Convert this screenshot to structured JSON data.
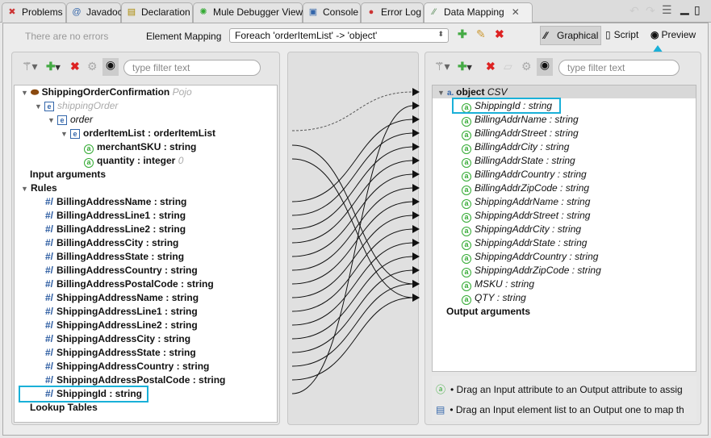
{
  "tabs": [
    {
      "label": "Problems",
      "icon": "problems-icon"
    },
    {
      "label": "Javadoc",
      "icon": "at-icon"
    },
    {
      "label": "Declaration",
      "icon": "declaration-icon"
    },
    {
      "label": "Mule Debugger View",
      "icon": "bug-icon"
    },
    {
      "label": "Console",
      "icon": "console-icon"
    },
    {
      "label": "Error Log",
      "icon": "error-log-icon"
    },
    {
      "label": "Data Mapping",
      "icon": "data-mapping-icon",
      "active": true
    }
  ],
  "toolbar": {
    "status": "There are no errors",
    "element_mapping_label": "Element Mapping",
    "element_mapping_value": "Foreach 'orderItemList' -> 'object'",
    "graphical": "Graphical",
    "script": "Script",
    "preview": "Preview"
  },
  "input": {
    "filter_placeholder": "type filter text",
    "root": {
      "name": "ShippingOrderConfirmation",
      "type": "Pojo"
    },
    "shipping_order": "shippingOrder",
    "order": "order",
    "item_list": "orderItemList : orderItemList",
    "merchant_sku": "merchantSKU : string",
    "quantity": "quantity : integer",
    "quantity_value": "0",
    "input_arguments": "Input arguments",
    "rules": "Rules",
    "rule_items": [
      "BillingAddressName : string",
      "BillingAddressLine1 : string",
      "BillingAddressLine2 : string",
      "BillingAddressCity : string",
      "BillingAddressState : string",
      "BillingAddressCountry : string",
      "BillingAddressPostalCode : string",
      "ShippingAddressName : string",
      "ShippingAddressLine1 : string",
      "ShippingAddressLine2 : string",
      "ShippingAddressCity : string",
      "ShippingAddressState : string",
      "ShippingAddressCountry : string",
      "ShippingAddressPostalCode : string",
      "ShippingId : string"
    ],
    "lookup_tables": "Lookup Tables"
  },
  "output": {
    "filter_placeholder": "type filter text",
    "root": {
      "name": "object",
      "type": "CSV"
    },
    "fields": [
      "ShippingId : string",
      "BillingAddrName : string",
      "BillingAddrStreet : string",
      "BillingAddrCity : string",
      "BillingAddrState : string",
      "BillingAddrCountry : string",
      "BillingAddrZipCode : string",
      "ShippingAddrName : string",
      "ShippingAddrStreet : string",
      "ShippingAddrCity : string",
      "ShippingAddrState : string",
      "ShippingAddrCountry : string",
      "ShippingAddrZipCode : string",
      "MSKU : string",
      "QTY : string"
    ],
    "output_arguments": "Output arguments"
  },
  "hints": [
    "• Drag an Input attribute to an Output attribute to assig",
    "• Drag an Input element list to an Output one to map th"
  ],
  "colors": {
    "highlight": "#1ab0d8"
  }
}
